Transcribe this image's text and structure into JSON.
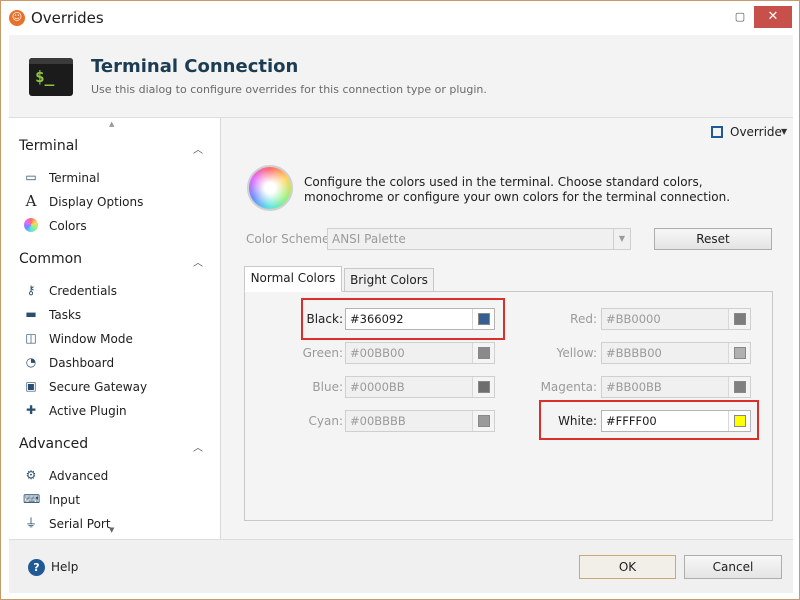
{
  "window": {
    "title": "Overrides",
    "maximize_icon": "maximize-icon",
    "close_icon": "close-icon"
  },
  "header": {
    "title": "Terminal Connection",
    "subtitle": "Use this dialog to configure overrides for this connection type or plugin.",
    "icon": "terminal-icon",
    "prompt": "$_"
  },
  "sidebar": {
    "sections": [
      {
        "title": "Terminal",
        "items": [
          {
            "label": "Terminal",
            "icon": "terminal-icon"
          },
          {
            "label": "Display Options",
            "icon": "font-icon"
          },
          {
            "label": "Colors",
            "icon": "palette-icon",
            "selected": true
          }
        ]
      },
      {
        "title": "Common",
        "items": [
          {
            "label": "Credentials",
            "icon": "key-icon"
          },
          {
            "label": "Tasks",
            "icon": "tasks-icon"
          },
          {
            "label": "Window Mode",
            "icon": "window-mode-icon"
          },
          {
            "label": "Dashboard",
            "icon": "dashboard-icon"
          },
          {
            "label": "Secure Gateway",
            "icon": "gateway-icon"
          },
          {
            "label": "Active Plugin",
            "icon": "plugin-icon"
          }
        ]
      },
      {
        "title": "Advanced",
        "items": [
          {
            "label": "Advanced",
            "icon": "advanced-icon"
          },
          {
            "label": "Input",
            "icon": "input-icon"
          },
          {
            "label": "Serial Port",
            "icon": "serial-port-icon"
          }
        ]
      }
    ]
  },
  "main": {
    "override_label": "Override",
    "description": "Configure the colors used in the terminal. Choose standard colors, monochrome or configure your own colors for the terminal connection.",
    "color_scheme": {
      "label": "Color Scheme:",
      "value": "ANSI Palette"
    },
    "reset_label": "Reset",
    "tabs": [
      {
        "label": "Normal Colors",
        "active": true
      },
      {
        "label": "Bright Colors",
        "active": false
      }
    ],
    "colors_left": [
      {
        "label": "Black:",
        "value": "#366092",
        "swatch": "#366092",
        "enabled": true,
        "highlighted": true
      },
      {
        "label": "Green:",
        "value": "#00BB00",
        "swatch": "#8a8a8a",
        "enabled": false
      },
      {
        "label": "Blue:",
        "value": "#0000BB",
        "swatch": "#6e6e6e",
        "enabled": false
      },
      {
        "label": "Cyan:",
        "value": "#00BBBB",
        "swatch": "#9a9a9a",
        "enabled": false
      }
    ],
    "colors_right": [
      {
        "label": "Red:",
        "value": "#BB0000",
        "swatch": "#7d7d7d",
        "enabled": false
      },
      {
        "label": "Yellow:",
        "value": "#BBBB00",
        "swatch": "#b0b0b0",
        "enabled": false
      },
      {
        "label": "Magenta:",
        "value": "#BB00BB",
        "swatch": "#808080",
        "enabled": false
      },
      {
        "label": "White:",
        "value": "#FFFF00",
        "swatch": "#FFFF00",
        "enabled": true,
        "highlighted": true
      }
    ]
  },
  "footer": {
    "help_label": "Help",
    "ok_label": "OK",
    "cancel_label": "Cancel"
  },
  "theme": {
    "accent": "#1f5a96",
    "highlight_border": "#d9302c",
    "close_button": "#c7504a",
    "title_color": "#1b3c52"
  }
}
